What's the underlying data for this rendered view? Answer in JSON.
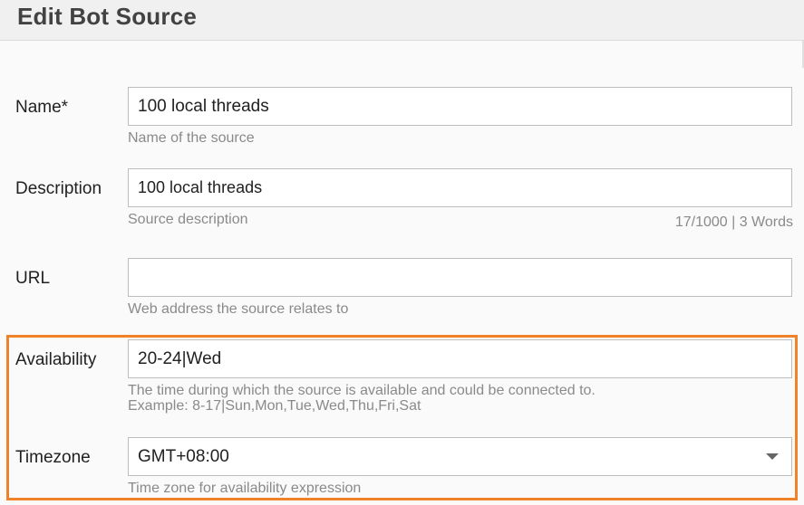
{
  "header": {
    "title": "Edit Bot Source"
  },
  "form": {
    "name": {
      "label": "Name*",
      "value": "100 local threads",
      "hint": "Name of the source"
    },
    "description": {
      "label": "Description",
      "value": "100 local threads",
      "hint": "Source description",
      "counter": "17/1000 | 3 Words"
    },
    "url": {
      "label": "URL",
      "value": "",
      "hint": "Web address the source relates to"
    },
    "availability": {
      "label": "Availability",
      "value": "20-24|Wed",
      "hint_line1": "The time during which the source is available and could be connected to.",
      "hint_line2": "Example: 8-17|Sun,Mon,Tue,Wed,Thu,Fri,Sat"
    },
    "timezone": {
      "label": "Timezone",
      "value": "GMT+08:00",
      "hint": "Time zone for availability expression",
      "icon": "chevron-down-icon"
    }
  },
  "colors": {
    "highlight": "#f0822a",
    "header_bg": "#f0f0f0",
    "hint_text": "#8a8a8a"
  }
}
